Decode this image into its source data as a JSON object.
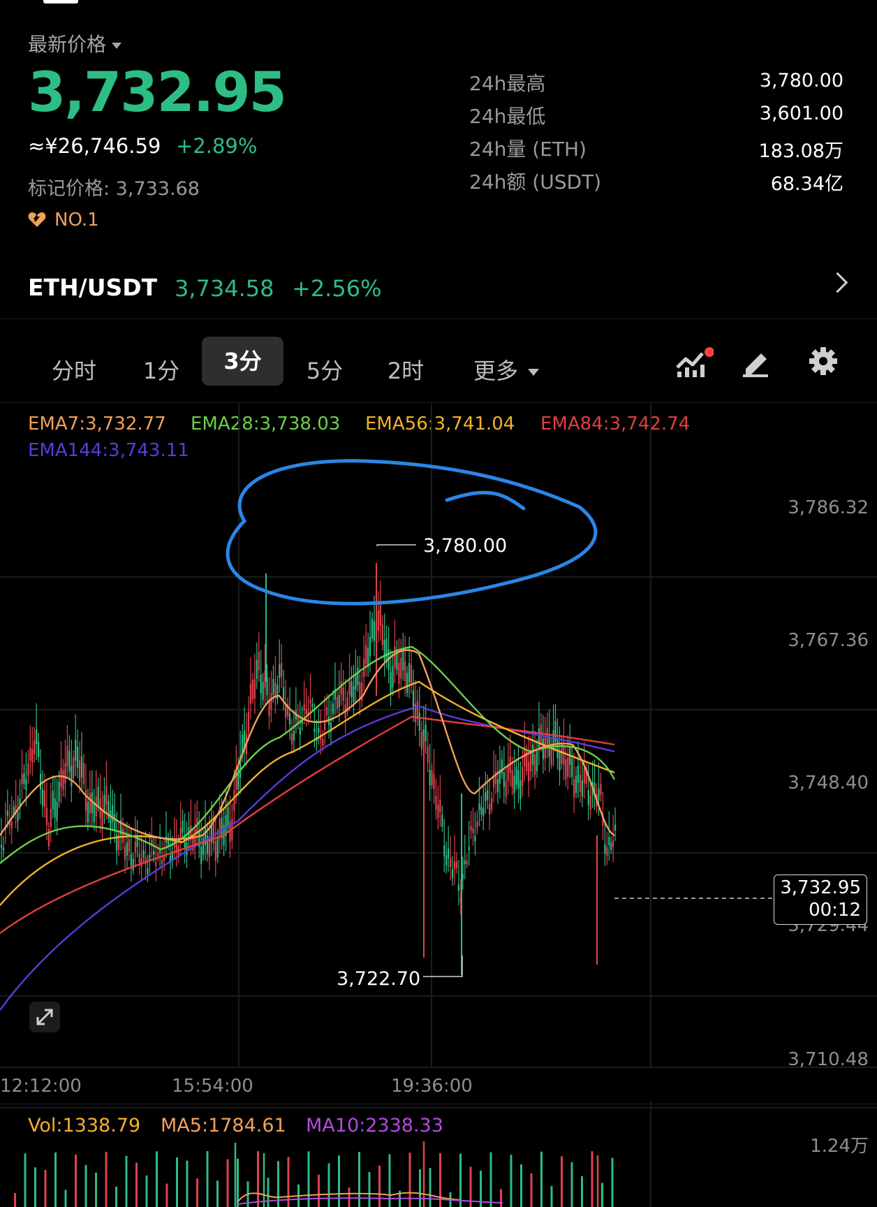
{
  "header": {
    "latest_label": "最新价格",
    "price": "3,732.95",
    "cny_price": "≈¥26,746.59",
    "change_pct": "+2.89%",
    "mark_price": "标记价格: 3,733.68",
    "rank": "NO.1"
  },
  "stats": [
    {
      "label": "24h最高",
      "value": "3,780.00"
    },
    {
      "label": "24h最低",
      "value": "3,601.00"
    },
    {
      "label": "24h量 (ETH)",
      "value": "183.08万"
    },
    {
      "label": "24h额 (USDT)",
      "value": "68.34亿"
    }
  ],
  "pair": {
    "name": "ETH/USDT",
    "price": "3,734.58",
    "change": "+2.56%"
  },
  "tabs": [
    {
      "label": "分时"
    },
    {
      "label": "1分"
    },
    {
      "label": "3分"
    },
    {
      "label": "5分"
    },
    {
      "label": "2时"
    },
    {
      "label": "更多"
    }
  ],
  "active_tab": "3分",
  "indicators": {
    "ema7": "EMA7:3,732.77",
    "ema28": "EMA28:3,738.03",
    "ema56": "EMA56:3,741.04",
    "ema84": "EMA84:3,742.74",
    "ema144": "EMA144:3,743.11"
  },
  "y_axis": [
    "3,786.32",
    "3,767.36",
    "3,748.40",
    "3,729.44",
    "3,710.48"
  ],
  "x_axis": [
    "12:12:00",
    "15:54:00",
    "19:36:00"
  ],
  "annotations": {
    "high": "3,780.00",
    "low": "3,722.70"
  },
  "current_tag": {
    "price": "3,732.95",
    "countdown": "00:12"
  },
  "volume": {
    "vol": "Vol:1338.79",
    "ma5": "MA5:1784.61",
    "ma10": "MA10:2338.33",
    "axis_top": "1.24万"
  },
  "colors": {
    "up": "#2dbd85",
    "down": "#e0434d",
    "ema7": "#f0a15a",
    "ema28": "#6ad14a",
    "ema56": "#f3b22c",
    "ema84": "#e23f3f",
    "ema144": "#5b3bd9",
    "circle": "#2b86e6"
  },
  "icons": [
    "indicator-chart-icon",
    "draw-pen-icon",
    "settings-gear-icon",
    "expand-icon",
    "chevron-right-icon"
  ]
}
